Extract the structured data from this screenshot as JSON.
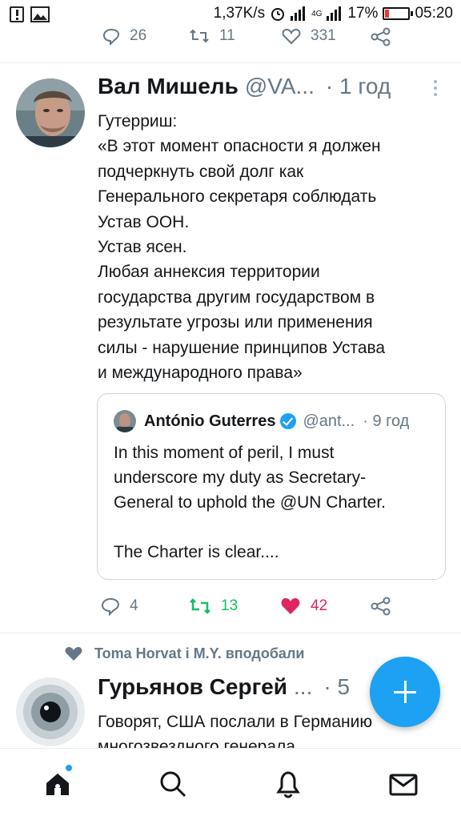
{
  "status_bar": {
    "speed": "1,37K/s",
    "network": "4G",
    "battery": "17%",
    "battery_level": 0.17,
    "time": "05:20"
  },
  "prev_tweet_actions": {
    "replies": "26",
    "retweets": "11",
    "likes": "331"
  },
  "tweet": {
    "author_name": "Вал Мишель",
    "handle": "@VA...",
    "time": "· 1 год",
    "lines": [
      "Гутерриш:",
      "«В этот момент опасности я должен",
      "подчеркнуть свой долг как",
      "Генерального секретаря соблюдать",
      "Устав ООН.",
      "Устав ясен.",
      "Любая аннексия территории",
      "государства другим государством в",
      "результате угрозы или применения",
      "силы - нарушение принципов Устава",
      "и международного права»"
    ],
    "quote": {
      "author_name": "António Guterres",
      "handle": "@ant...",
      "time": "· 9 год",
      "lines": [
        "In this moment of peril, I must",
        "underscore my duty as Secretary-",
        "General to uphold the @UN Charter.",
        "",
        "The Charter is clear...."
      ]
    },
    "actions": {
      "replies": "4",
      "retweets": "13",
      "likes": "42"
    },
    "colors": {
      "retweet": "#17bf63",
      "like": "#e0245e"
    }
  },
  "tweet2": {
    "liked_by": "Toma Horvat i M.Y. вподобали",
    "author_name": "Гурьянов Сергей",
    "handle": "...",
    "time": "· 5",
    "text_line1": "Говорят, США послали в Германию",
    "text_line2": "многозвездного генерала"
  },
  "nav": {
    "items": [
      "home-icon",
      "search-icon",
      "bell-icon",
      "mail-icon"
    ],
    "accent": "#1da1f2"
  }
}
